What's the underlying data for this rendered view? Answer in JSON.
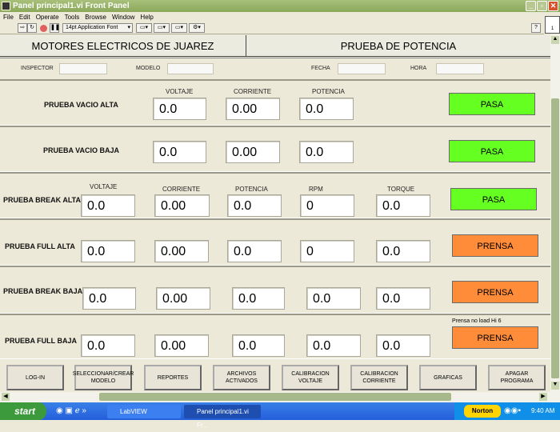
{
  "window": {
    "title": "Panel principal1.vi Front Panel"
  },
  "menu": [
    "File",
    "Edit",
    "Operate",
    "Tools",
    "Browse",
    "Window",
    "Help"
  ],
  "toolbar": {
    "font": "14pt Application Font"
  },
  "header": {
    "company": "MOTORES ELECTRICOS DE JUAREZ",
    "test": "PRUEBA DE POTENCIA"
  },
  "info": {
    "inspector": "INSPECTOR",
    "modelo": "MODELO",
    "fecha": "FECHA",
    "hora": "HORA"
  },
  "columns": {
    "voltaje": "VOLTAJE",
    "corriente": "CORRIENTE",
    "potencia": "POTENCIA",
    "rpm": "RPM",
    "torque": "TORQUE"
  },
  "rows": [
    {
      "label": "PRUEBA VACIO ALTA",
      "values": [
        "0.0",
        "0.00",
        "0.0"
      ],
      "status": "PASA"
    },
    {
      "label": "PRUEBA VACIO BAJA",
      "values": [
        "0.0",
        "0.00",
        "0.0"
      ],
      "status": "PASA"
    },
    {
      "label": "PRUEBA BREAK ALTA",
      "values": [
        "0.0",
        "0.00",
        "0.0",
        "0",
        "0.0"
      ],
      "status": "PASA"
    },
    {
      "label": "PRUEBA FULL ALTA",
      "values": [
        "0.0",
        "0.00",
        "0.0",
        "0",
        "0.0"
      ],
      "status": "PRENSA"
    },
    {
      "label": "PRUEBA BREAK BAJA",
      "values": [
        "0.0",
        "0.00",
        "0.0",
        "0.0",
        "0.0"
      ],
      "status": "PRENSA"
    },
    {
      "label": "PRUEBA FULL BAJA",
      "values": [
        "0.0",
        "0.00",
        "0.0",
        "0.0",
        "0.0"
      ],
      "status": "PRENSA",
      "note": "Prensa no load Hi 6"
    }
  ],
  "buttons": [
    "LOG-IN",
    "SELECCIONAR/CREAR MODELO",
    "REPORTES",
    "ARCHIVOS ACTIVADOS",
    "CALIBRACION VOLTAJE",
    "CALIBRACION CORRIENTE",
    "GRAFICAS",
    "APAGAR PROGRAMA"
  ],
  "taskbar": {
    "start": "start",
    "items": [
      "LabVIEW",
      "Panel principal1.vi Fr..."
    ],
    "norton": "Norton",
    "time": "9:40 AM"
  },
  "colors": {
    "pasa": "#66ff22",
    "prensa": "#ff8c38"
  }
}
